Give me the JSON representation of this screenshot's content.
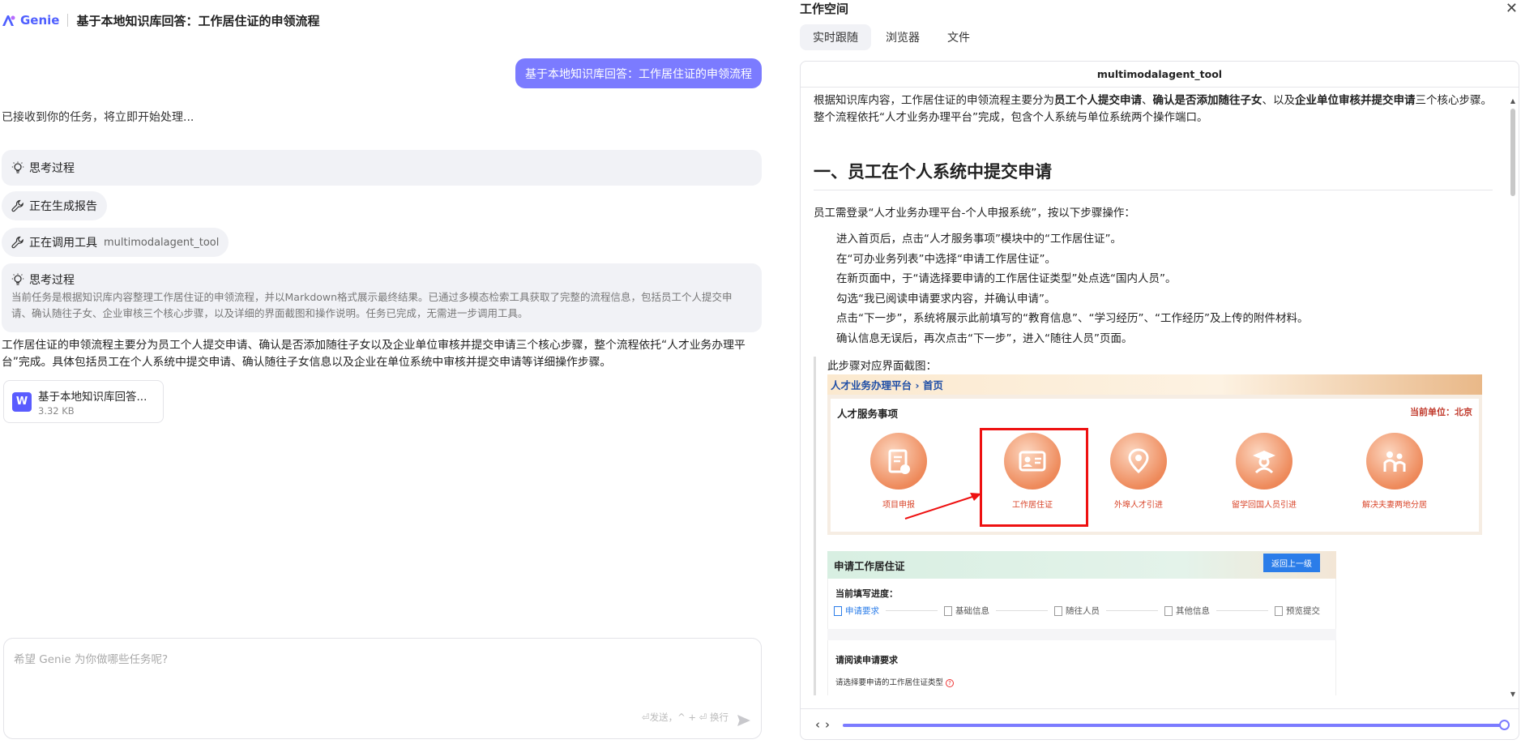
{
  "app": {
    "name": "Genie",
    "conversation_title": "基于本地知识库回答：工作居住证的申领流程"
  },
  "chat": {
    "user_message": "基于本地知识库回答：工作居住证的申领流程",
    "ack": "已接收到你的任务，将立即开始处理...",
    "thinking_1_label": "思考过程",
    "status_generating": "正在生成报告",
    "status_tool_label": "正在调用工具",
    "status_tool_name": "multimodalagent_tool",
    "thinking_2_label": "思考过程",
    "thinking_2_body": "当前任务是根据知识库内容整理工作居住证的申领流程，并以Markdown格式展示最终结果。已通过多模态检索工具获取了完整的流程信息，包括员工个人提交申请、确认随往子女、企业审核三个核心步骤，以及详细的界面截图和操作说明。任务已完成，无需进一步调用工具。",
    "answer": "工作居住证的申领流程主要分为员工个人提交申请、确认是否添加随往子女以及企业单位审核并提交申请三个核心步骤，整个流程依托“人才业务办理平台”完成。具体包括员工在个人系统中提交申请、确认随往子女信息以及企业在单位系统中审核并提交申请等详细操作步骤。",
    "file": {
      "name": "基于本地知识库回答...",
      "size": "3.32 KB",
      "icon_letter": "W"
    }
  },
  "input": {
    "placeholder": "希望 Genie 为你做哪些任务呢?",
    "hint": "⏎发送，^ + ⏎ 换行"
  },
  "workspace": {
    "title": "工作空间",
    "tabs": [
      "实时跟随",
      "浏览器",
      "文件"
    ],
    "active_tab": 0,
    "viewer_title": "multimodalagent_tool",
    "intro_parts": [
      "根据知识库内容，工作居住证的申领流程主要分为",
      "员工个人提交申请",
      "、",
      "确认是否添加随往子女",
      "、以及",
      "企业单位审核并提交申请",
      "三个核心步骤。整个流程依托“人才业务办理平台”完成，包含个人系统与单位系统两个操作端口。"
    ],
    "section_heading": "一、员工在个人系统中提交申请",
    "section_lead": "员工需登录“人才业务办理平台-个人申报系统”，按以下步骤操作：",
    "steps": [
      "进入首页后，点击“人才服务事项”模块中的“工作居住证”。",
      "在“可办业务列表”中选择“申请工作居住证”。",
      "在新页面中，于“请选择要申请的工作居住证类型”处点选“国内人员”。",
      "勾选“我已阅读申请要求内容，并确认申请”。",
      "点击“下一步”，系统将展示此前填写的“教育信息”、“学习经历”、“工作经历”及上传的附件材料。",
      "确认信息无误后，再次点击“下一步”，进入“随往人员”页面。"
    ],
    "screenshot_caption": "此步骤对应界面截图：",
    "shot1": {
      "breadcrumb": "人才业务办理平台  ›  首页",
      "card_title": "人才服务事项",
      "unit_label": "当前单位：北京",
      "services": [
        "项目申报",
        "工作居住证",
        "外埠人才引进",
        "留学回国人员引进",
        "解决夫妻两地分居"
      ]
    },
    "shot2": {
      "title": "申请工作居住证",
      "back_button": "返回上一级",
      "progress_label": "当前填写进度：",
      "progress_steps": [
        "申请要求",
        "基础信息",
        "随往人员",
        "其他信息",
        "预览提交"
      ],
      "read_label": "请阅读申请要求",
      "type_label": "请选择要申请的工作居住证类型"
    },
    "progress_fraction": 1.0
  },
  "colors": {
    "accent": "#7b7bff",
    "brand": "#4f5fff",
    "highlight_red": "#e11111"
  }
}
